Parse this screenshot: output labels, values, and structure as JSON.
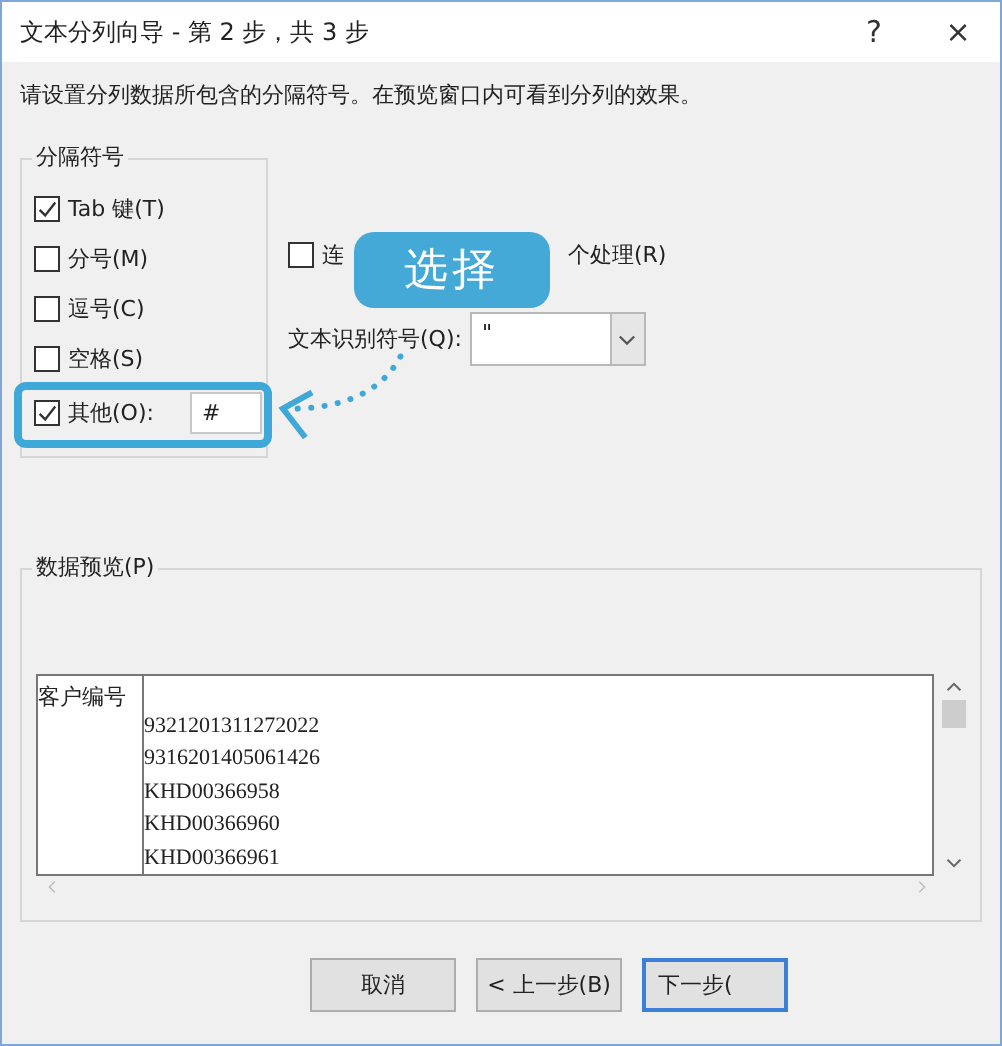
{
  "window": {
    "title": "文本分列向导 - 第 2 步，共 3 步",
    "help": "?",
    "close": "×"
  },
  "instruction": "请设置分列数据所包含的分隔符号。在预览窗口内可看到分列的效果。",
  "delimiters": {
    "title": "分隔符号",
    "items": [
      {
        "kind": "check",
        "label": "Tab 键(T)",
        "checked": true
      },
      {
        "kind": "check",
        "label": "分号(M)",
        "checked": false
      },
      {
        "kind": "check",
        "label": "逗号(C)",
        "checked": false
      },
      {
        "kind": "check",
        "label": "空格(S)",
        "checked": false
      },
      {
        "kind": "other",
        "label": "其他(O):",
        "checked": true,
        "value": "#"
      }
    ]
  },
  "consecutive": {
    "label_parts": [
      "连",
      "个处理(R)"
    ],
    "checked": false
  },
  "qualifier": {
    "label": "文本识别符号(Q):",
    "value": "\""
  },
  "callout": {
    "text": "选择"
  },
  "preview": {
    "title": "数据预览(P)",
    "column_1": [
      "客户编号"
    ],
    "column_2": [
      "9321201311272022",
      "9316201405061426",
      "KHD00366958",
      "KHD00366960",
      "KHD00366961"
    ]
  },
  "buttons": [
    {
      "label": "取消",
      "default": false
    },
    {
      "label": "< 上一步(B)",
      "default": false
    },
    {
      "label": "下一步(",
      "default": true
    }
  ]
}
